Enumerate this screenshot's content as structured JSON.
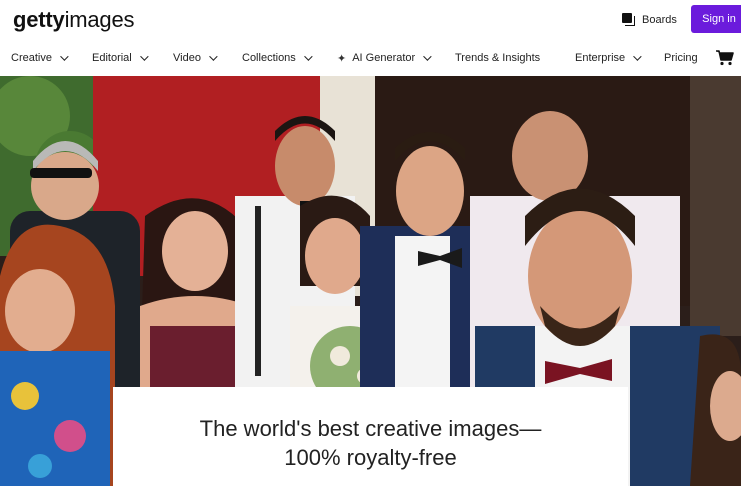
{
  "header": {
    "logo_bold": "getty",
    "logo_normal": "images",
    "boards_label": "Boards",
    "signin_label": "Sign in"
  },
  "nav": {
    "items": [
      {
        "label": "Creative",
        "dropdown": true
      },
      {
        "label": "Editorial",
        "dropdown": true
      },
      {
        "label": "Video",
        "dropdown": true
      },
      {
        "label": "Collections",
        "dropdown": true
      },
      {
        "label": "AI Generator",
        "dropdown": true,
        "icon": "sparkle-icon"
      },
      {
        "label": "Trends & Insights",
        "dropdown": false
      },
      {
        "label": "Enterprise",
        "dropdown": true
      },
      {
        "label": "Pricing",
        "dropdown": false
      }
    ],
    "cart_icon": "cart-icon"
  },
  "hero": {
    "headline_line1": "The world's best creative images—",
    "headline_line2": "100% royalty-free"
  },
  "colors": {
    "accent": "#6b1bdc",
    "text": "#222222"
  }
}
